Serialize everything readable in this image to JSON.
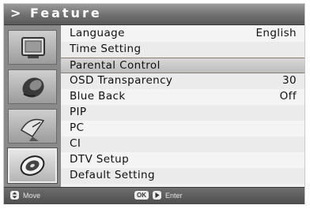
{
  "header": {
    "title": "> Feature"
  },
  "sidebar": {
    "icons": [
      {
        "name": "tv-screen-icon",
        "active": false
      },
      {
        "name": "sound-speaker-icon",
        "active": false
      },
      {
        "name": "satellite-dish-icon",
        "active": false
      },
      {
        "name": "feature-disc-icon",
        "active": true
      }
    ]
  },
  "menu": {
    "items": [
      {
        "label": "Language",
        "value": "English",
        "selected": false
      },
      {
        "label": "Time Setting",
        "value": "",
        "selected": false
      },
      {
        "label": "Parental Control",
        "value": "",
        "selected": true
      },
      {
        "label": "OSD Transparency",
        "value": "30",
        "selected": false
      },
      {
        "label": "Blue Back",
        "value": "Off",
        "selected": false
      },
      {
        "label": "PIP",
        "value": "",
        "selected": false
      },
      {
        "label": "PC",
        "value": "",
        "selected": false
      },
      {
        "label": "CI",
        "value": "",
        "selected": false
      },
      {
        "label": "DTV Setup",
        "value": "",
        "selected": false
      },
      {
        "label": "Default Setting",
        "value": "",
        "selected": false
      }
    ]
  },
  "footer": {
    "move_label": "Move",
    "ok_key": "OK",
    "enter_label": "Enter"
  }
}
